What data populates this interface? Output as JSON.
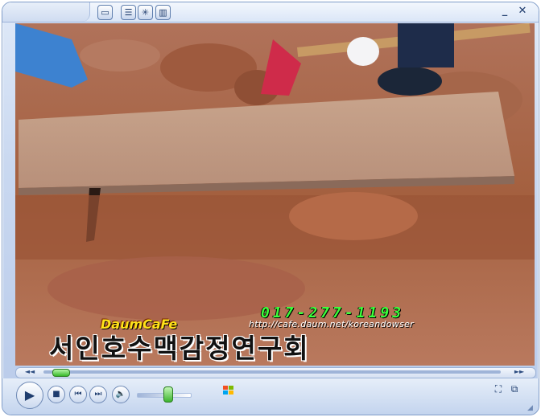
{
  "titlebar": {
    "left_buttons": [
      "folder-icon",
      "list-icon",
      "visualization-icon",
      "equalizer-icon"
    ],
    "minimize": "_",
    "close": "✕"
  },
  "video": {
    "overlay_phone": "017-277-1193",
    "overlay_url": "http://cafe.daum.net/koreandowser",
    "overlay_cafe": "DaumCaFe",
    "overlay_korean": "서인호수맥감정연구회"
  },
  "seek": {
    "left_arrow": "◄◄",
    "right_arrow": "►►",
    "position_fraction": 0.02
  },
  "controls": {
    "play": "▶",
    "stop": "■",
    "prev": "⏮",
    "next": "⏭",
    "mute": "🔈",
    "volume_fraction": 0.62
  },
  "colors": {
    "accent": "#3cb42e",
    "frame": "#7f9cc8"
  }
}
